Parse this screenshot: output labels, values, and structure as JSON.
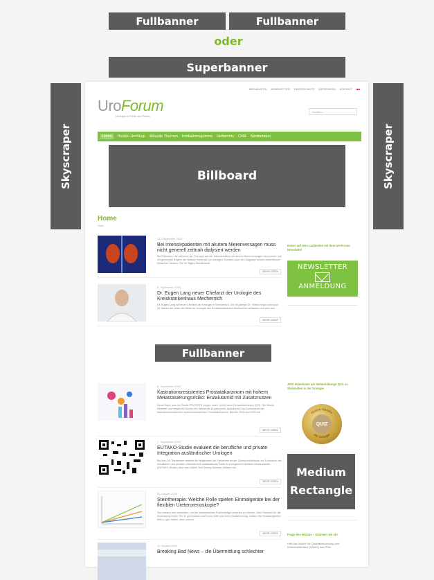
{
  "ad_slots": {
    "fullbanner_top_left": "Fullbanner",
    "fullbanner_top_right": "Fullbanner",
    "oder": "oder",
    "superbanner": "Superbanner",
    "skyscraper_left": "Skyscraper",
    "skyscraper_right": "Skyscraper",
    "billboard": "Billboard",
    "fullbanner_middle": "Fullbanner",
    "medium_rectangle_line1": "Medium",
    "medium_rectangle_line2": "Rectangle"
  },
  "colors": {
    "ad_slot": "#5b5b5b",
    "accent_green": "#7fc242",
    "oder_text": "#7fba2b"
  },
  "website": {
    "top_links": [
      "MEDIADATEN",
      "NEWSLETTER",
      "DATENSCHUTZ",
      "IMPRESSUM",
      "KONTAKT"
    ],
    "logo_uro": "Uro",
    "logo_forum": "Forum",
    "tagline": "Urologie in Klinik und Praxis",
    "search_placeholder": "Suchen...",
    "nav": [
      "Home",
      "Punkto UroSkop",
      "Aktuelle Themen",
      "Indikationsgebiete",
      "Heftarchiv",
      "CME",
      "Mediadaten"
    ],
    "page_heading": "Home",
    "breadcrumb": "Start",
    "articles": [
      {
        "date": "13. September 2020",
        "title": "Bei Intensivpatienten mit akutem Nierenversagen muss nicht generell zeitnah dialysiert werden",
        "excerpt": "Bei Patienten, die während der Therapie auf der Intensivstation ein akutes Nierenversagen bekommen, hat ein genereller Beginn der Dialyse innerhalb von wenigen Stunden nach der Diagnose keinen wesentlichen klinischen Nutzen. Die 90-Tages-Sterblichkeit",
        "more": "MEHR LESEN"
      },
      {
        "date": "8. September 2020",
        "title": "Dr. Eugen Lang neuer Chefarzt der Urologie des Kreiskrankenhaus Mechernich",
        "excerpt": "Dr. Eugen Lang ist neuer Chefarzt der Urologie in Mechernich. Die 90-jährige Dr. Vilfred Keglo wird nach 26 Jahren als Leiter der Klinik für Urologie des Kreiskrankenhaus Mechernich verlassen und sich neu",
        "more": "MEHR LESEN"
      },
      {
        "date": "8. September 2020",
        "title": "Kastrationsresistentes Prostatakarzinom mit hohem Metastasierungsrisiko: Enzalutamid mit Zusatznutzen",
        "excerpt": "Neue Daten aus der Studie PROSPER zeigen einen Vorteil beim Gesamtüberleben (OS). Die Studie bewertet und vergleicht Nutzen der Wirkstoffe Enzalutamid, Apalutamid und Darolutamid bei kastrationsresistenten nicht-metastasierten Prostatakarzinom. Bereits 2019 und 2020 hat",
        "more": "MEHR LESEN"
      },
      {
        "date": "7. September 2020",
        "title": "EUTAKO-Studie evaluiert die berufliche und private Integration ausländischer Urologen",
        "excerpt": "Bis zum 30. September besteht die Möglichkeit der Teilnahme an der Querschnittsstudie zur Evaluation der beruflichen und privaten Zufriedenheit ausländischer Ärzte in urologischen Kliniken Deutschlands (EUTAKO-Studie) über das Online-Tool Survey Monkey. Initiator der",
        "more": "MEHR LESEN"
      },
      {
        "date": "31. August 2020",
        "title": "Steintherapie: Welche Rolle spielen Einmalgeräte bei der flexiblen Ureterorenoskopie?",
        "excerpt": "Sie müssen sich anmelden, um die medizinischen Fachbeiträge ansehen zu können. Das Passwort für die Anmeldung finden Sie im gedruckten UroForum-Heft oder beim Medizinverlag. Sollten Sie Schwierigkeiten beim Login haben, dann nutzen",
        "more": "MEHR LESEN"
      },
      {
        "date": "31. August 2020",
        "title": "Breaking Bad News – die Übermittlung schlechter",
        "excerpt": "",
        "more": ""
      }
    ],
    "sidebar": {
      "newsletter_heading": "Immer auf dem Laufenden mit dem UroForum Newsletter",
      "newsletter_line1": "NEWSLETTER",
      "newsletter_line2": "ANMELDUNG",
      "quiz_heading": "Jetzt teilnehmen am Weiterbildungs-Quiz zu Steinleiden in der Urologie",
      "quiz_badge": "QUIZ",
      "quiz_ring_top": "Online-Update",
      "quiz_ring_bottom": "der Urologie",
      "question_heading": "Frage des Monats – Stimmen Sie ab!",
      "question_text": "Hält das Institut für Qualitätssicherung und Wirtschaftlichkeit (IQWiG) das PSA-"
    }
  }
}
